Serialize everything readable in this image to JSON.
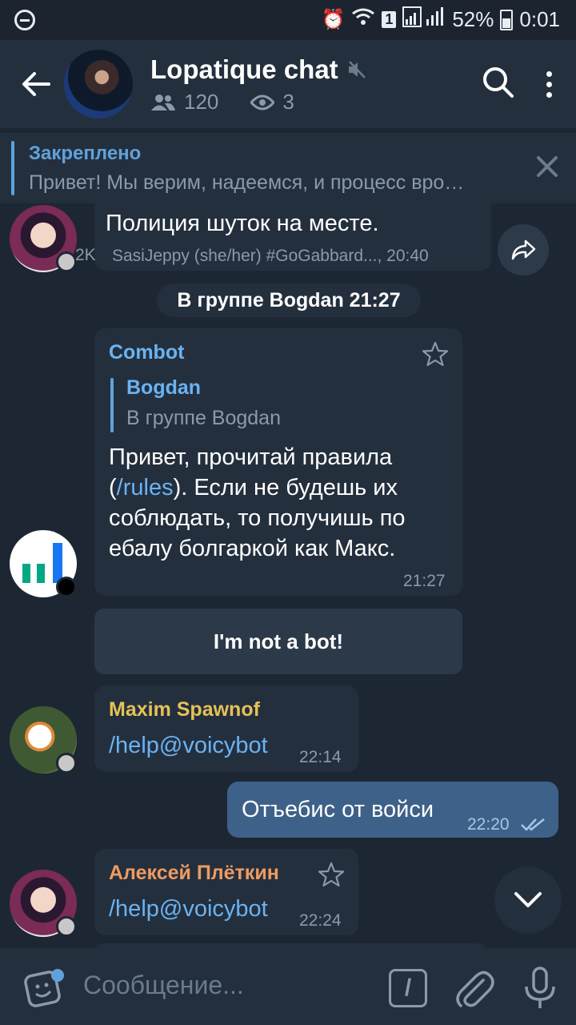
{
  "status_bar": {
    "battery": "52%",
    "time": "0:01",
    "sim": "1"
  },
  "header": {
    "title": "Lopatique chat",
    "members": "120",
    "online": "3"
  },
  "pinned": {
    "title": "Закреплено",
    "text": "Привет! Мы верим, надеемся, и процесс вро…"
  },
  "messages": [
    {
      "text": "Полиция шуток на месте.",
      "left_fragment": "2K",
      "footer": "SasiJeppy (she/her) #GoGabbard..., 20:40"
    },
    {
      "date_pill": "В группе Bogdan  21:27"
    },
    {
      "sender": "Combot",
      "reply_name": "Bogdan",
      "reply_text": "В группе Bogdan",
      "text_line1": "Привет, прочитай правила",
      "text_open": "(",
      "text_link": "/rules",
      "text_line2_rest": "). Если не будешь их",
      "text_line3": "соблюдать, то получишь по",
      "text_line4": "ебалу болгаркой как Макс.",
      "time": "21:27",
      "button": "I'm not a bot!"
    },
    {
      "sender": "Maxim Spawnof",
      "text": "/help@voicybot",
      "time": "22:14"
    },
    {
      "text": "Отъебис от войси",
      "time": "22:20",
      "outgoing": true
    },
    {
      "sender": "Алексей Плёткин",
      "text": "/help@voicybot",
      "time": "22:24"
    }
  ],
  "input": {
    "placeholder": "Сообщение...",
    "command_icon": "/"
  },
  "colors": {
    "accent": "#5fa2db",
    "combot_name": "#6ab3f3",
    "maxim_name": "#e5c157",
    "aleksey_name": "#ee9b62",
    "outgoing_bubble": "#3e6189"
  },
  "icons": [
    "dnd-icon",
    "alarm-icon",
    "wifi-icon",
    "signal-icon",
    "battery-icon",
    "back-arrow-icon",
    "mute-icon",
    "members-icon",
    "eye-icon",
    "search-icon",
    "more-vertical-icon",
    "close-icon",
    "share-icon",
    "star-icon",
    "double-check-icon",
    "chevron-down-icon",
    "sticker-icon",
    "slash-command-icon",
    "paperclip-icon",
    "mic-icon"
  ]
}
